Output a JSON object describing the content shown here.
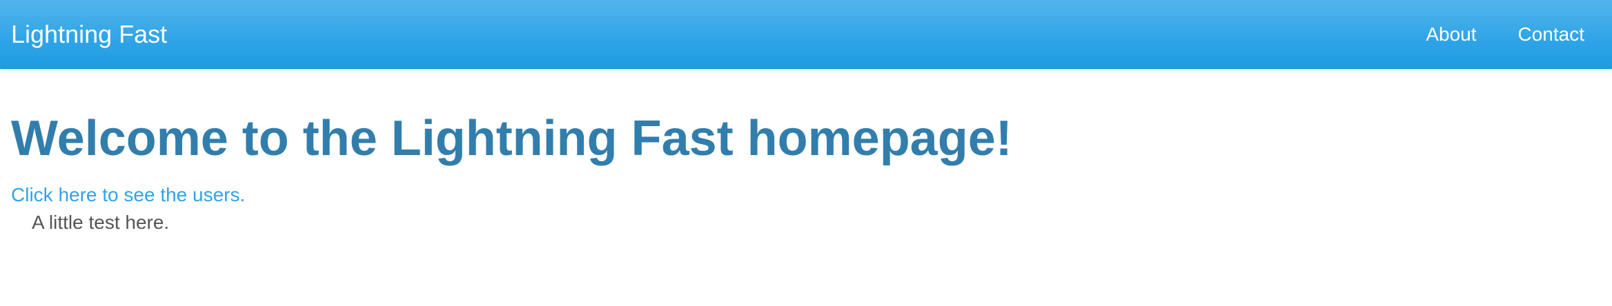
{
  "navbar": {
    "brand": "Lightning Fast",
    "links": [
      {
        "label": "About"
      },
      {
        "label": "Contact"
      }
    ]
  },
  "main": {
    "title": "Welcome to the Lightning Fast homepage!",
    "users_link": "Click here to see the users.",
    "note": "A little test here."
  },
  "colors": {
    "navbar_accent": "#2fa4e7",
    "title": "#317eac",
    "link": "#2fa4e7",
    "text": "#555555"
  }
}
